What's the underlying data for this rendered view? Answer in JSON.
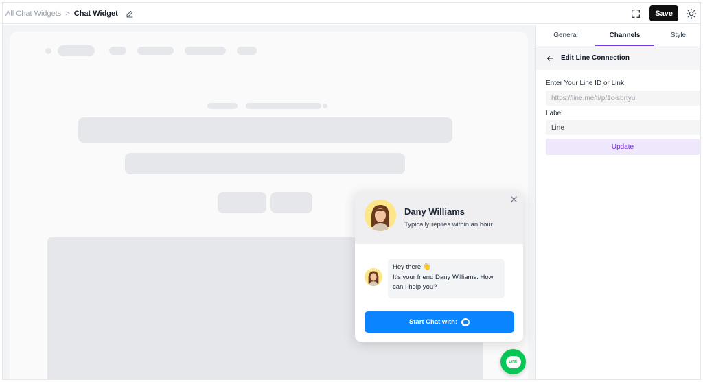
{
  "breadcrumb": {
    "parent": "All Chat Widgets",
    "separator": ">",
    "current": "Chat Widget"
  },
  "toolbar": {
    "save_label": "Save"
  },
  "panel": {
    "tabs": [
      {
        "label": "General",
        "active": false
      },
      {
        "label": "Channels",
        "active": true
      },
      {
        "label": "Style",
        "active": false
      }
    ],
    "subheader": "Edit Line Connection",
    "line_id_label": "Enter Your Line ID or Link:",
    "line_id_placeholder": "https://line.me/ti/p/1c-sbrtyul",
    "label_label": "Label",
    "label_value": "Line",
    "update_label": "Update"
  },
  "widget": {
    "name": "Dany Williams",
    "status": "Typically replies within an hour",
    "message_line1": "Hey there 👋",
    "message_line2": "It's your friend Dany Williams. How",
    "message_line3": "can I help you?",
    "start_chat_label": "Start Chat with:",
    "fab_text": "LINE"
  },
  "colors": {
    "accent": "#7c3aed",
    "line_green": "#06c755",
    "button_blue": "#0a84ff",
    "update_bg": "#efe7fb"
  }
}
